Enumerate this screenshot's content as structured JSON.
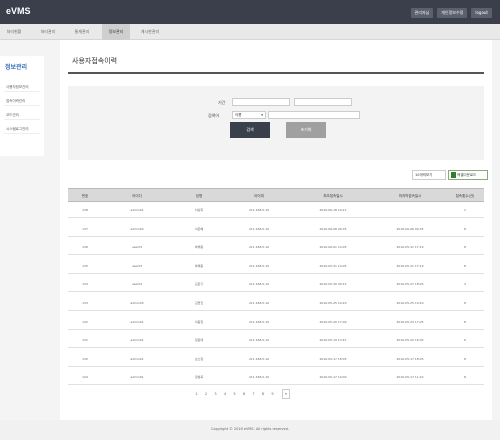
{
  "app": {
    "logo": "eVMS"
  },
  "header": {
    "top_links": [
      "관리자님",
      "개인정보수정",
      "logout"
    ]
  },
  "nav": {
    "tabs": [
      {
        "label": "처리현황",
        "active": false
      },
      {
        "label": "처리관리",
        "active": false
      },
      {
        "label": "통계관리",
        "active": false
      },
      {
        "label": "정보관리",
        "active": true
      },
      {
        "label": "게시판관리",
        "active": false
      }
    ]
  },
  "sidebar": {
    "title": "정보관리",
    "items": [
      "사용자정보관리",
      "접속이력관리",
      "코드관리",
      "시스템로그관리"
    ]
  },
  "main": {
    "page_title": "사용자접속이력"
  },
  "search": {
    "period_label": "기간",
    "keyword_label": "검색어",
    "keyword_option": "이름",
    "search_button": "검색",
    "reset_button": "초기화"
  },
  "toolbar": {
    "perpage": "10개씩보기",
    "excel": "엑셀다운로드"
  },
  "table": {
    "columns": [
      "번호",
      "아이디",
      "성명",
      "아이피",
      "최초접속일시",
      "마지막접속일시",
      "접속횟수(건)"
    ],
    "rows": [
      [
        "138",
        "admin01",
        "이상희",
        "211.168.0.10",
        "2016-06-18 10:21",
        "",
        "1"
      ],
      [
        "137",
        "admin02",
        "이은혜",
        "211.168.0.10",
        "2016-06-08 09:35",
        "2016-06-08 09:35",
        "8"
      ],
      [
        "136",
        "user03",
        "박해종",
        "211.168.0.10",
        "2016-06-01 14:05",
        "2016-05-31 17:19",
        "8"
      ],
      [
        "135",
        "user03",
        "박해종",
        "211.168.0.10",
        "2016-05-31 14:05",
        "2016-05-31 17:19",
        "8"
      ],
      [
        "134",
        "user04",
        "김은기",
        "211.168.0.10",
        "2016-05-30 09:12",
        "2016-05-27 18:05",
        "3"
      ],
      [
        "133",
        "admin05",
        "김현진",
        "211.168.0.10",
        "2016-05-25 10:20",
        "2016-05-25 10:20",
        "8"
      ],
      [
        "132",
        "admin01",
        "이동철",
        "211.168.0.10",
        "2016-05-20 17:09",
        "2016-05-23 17:05",
        "8"
      ],
      [
        "131",
        "admin01",
        "정윤택",
        "211.168.0.10",
        "2016-05-19 13:47",
        "2016-05-20 16:05",
        "6"
      ],
      [
        "130",
        "admin01",
        "손소정",
        "211.168.0.10",
        "2016-05-17 18:05",
        "2016-05-17 18:05",
        "8"
      ],
      [
        "129",
        "admin01",
        "정필욱",
        "211.168.0.10",
        "2016-05-17 10:00",
        "2016-05-17 11:22",
        "8"
      ]
    ]
  },
  "pagination": {
    "pages": [
      "1",
      "2",
      "3",
      "4",
      "5",
      "6",
      "7",
      "8",
      "9"
    ],
    "active_page": "1",
    "next": "»"
  },
  "footer": {
    "text": "Copyright © 2016 eVMS. All rights reserved."
  }
}
